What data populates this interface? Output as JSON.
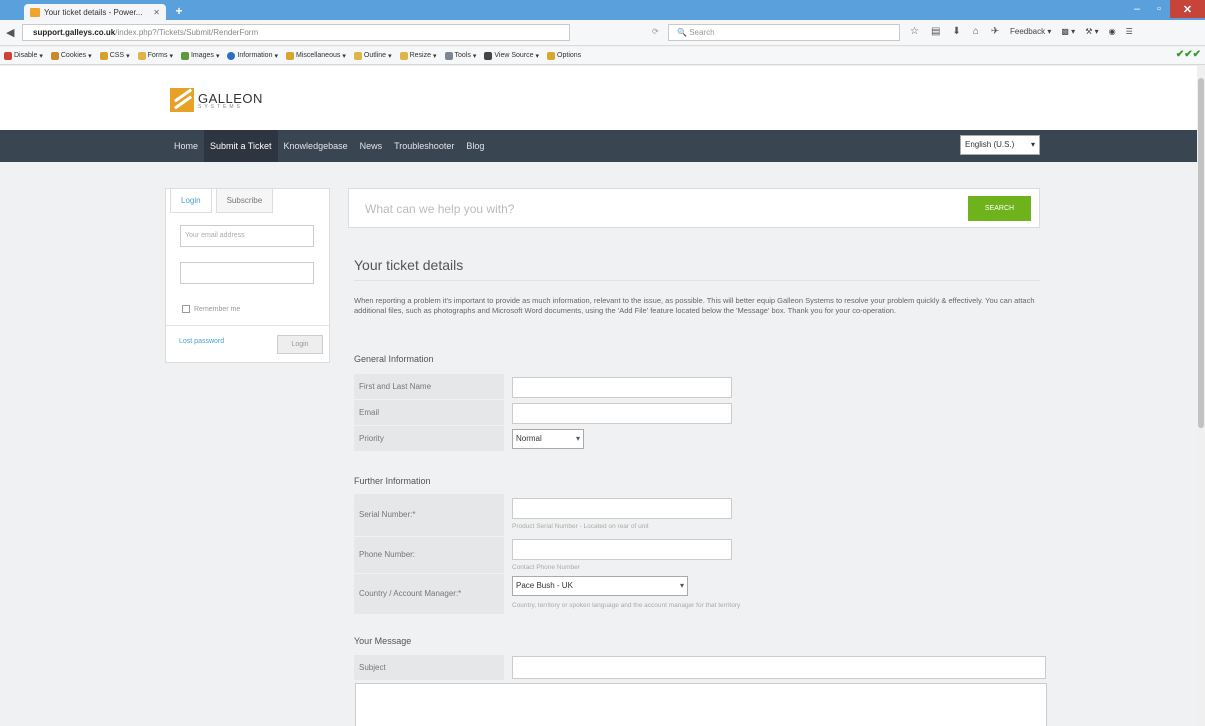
{
  "browser": {
    "tab_title": "Your ticket details - Power...",
    "url_host": "support.galleys.co.uk",
    "url_rest": "/index.php?/Tickets/Submit/RenderForm",
    "search_placeholder": "Search",
    "feedback_label": "Feedback",
    "bookmarks": [
      "Disable",
      "Cookies",
      "CSS",
      "Forms",
      "Images",
      "Information",
      "Miscellaneous",
      "Outline",
      "Resize",
      "Tools",
      "View Source",
      "Options"
    ]
  },
  "site": {
    "logo_text": "GALLEON",
    "logo_sub": "SYSTEMS",
    "nav": [
      "Home",
      "Submit a Ticket",
      "Knowledgebase",
      "News",
      "Troubleshooter",
      "Blog"
    ],
    "language": "English (U.S.)"
  },
  "login": {
    "tab_login": "Login",
    "tab_subscribe": "Subscribe",
    "email_placeholder": "Your email address",
    "remember": "Remember me",
    "lost_password": "Lost password",
    "login_button": "Login"
  },
  "search": {
    "placeholder": "What can we help you with?",
    "button": "SEARCH"
  },
  "ticket": {
    "title": "Your ticket details",
    "intro": "When reporting a problem it's important to provide as much information, relevant to the issue, as possible. This will better equip Galleon Systems to resolve your problem quickly & effectively. You can attach additional files, such as photographs and Microsoft Word documents, using the 'Add File' feature located below the 'Message' box. Thank you for your co-operation.",
    "general_heading": "General Information",
    "name_label": "First and Last Name",
    "email_label": "Email",
    "priority_label": "Priority",
    "priority_value": "Normal",
    "further_heading": "Further Information",
    "serial_label": "Serial Number:*",
    "serial_hint": "Product Serial Number - Located on rear of unit",
    "phone_label": "Phone Number:",
    "phone_hint": "Contact Phone Number",
    "country_label": "Country / Account Manager:*",
    "country_value": "Pace Bush - UK",
    "country_hint": "Country, territory or spoken language and the account manager for that territory",
    "message_heading": "Your Message",
    "subject_label": "Subject"
  }
}
